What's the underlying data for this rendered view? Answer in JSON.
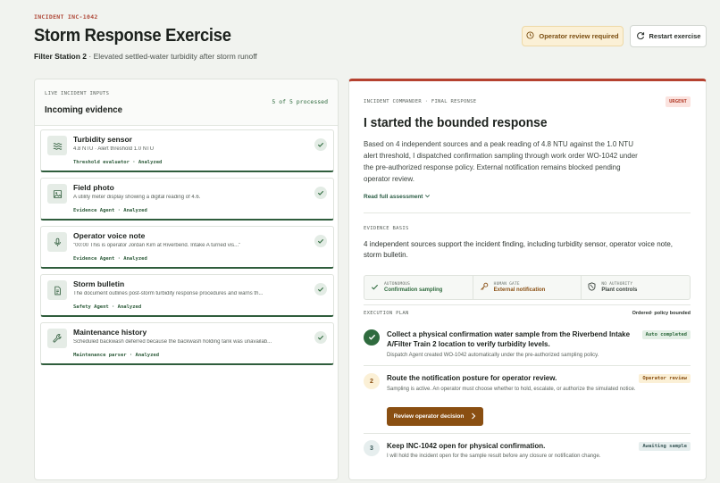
{
  "header": {
    "incident_code": "INCIDENT INC-1042",
    "title": "Storm Response Exercise",
    "station": "Filter Station 2",
    "subtitle": "· Elevated settled-water turbidity after storm runoff",
    "review_button": "Operator review required",
    "restart_button": "Restart exercise"
  },
  "evidence_panel": {
    "label": "LIVE INCIDENT INPUTS",
    "title": "Incoming evidence",
    "count": "5 of 5 processed",
    "items": [
      {
        "title": "Turbidity sensor",
        "desc": "4.8 NTU · Alert threshold 1.0 NTU",
        "agent": "Threshold evaluator · Analyzed",
        "icon": "waves-icon"
      },
      {
        "title": "Field photo",
        "desc": "A utility meter display showing a digital reading of 4.6.",
        "agent": "Evidence Agent · Analyzed",
        "icon": "image-icon"
      },
      {
        "title": "Operator voice note",
        "desc": "\"00:00 This is operator Jordan Kim at Riverbend. Intake A turned vis...\"",
        "agent": "Evidence Agent · Analyzed",
        "icon": "microphone-icon"
      },
      {
        "title": "Storm bulletin",
        "desc": "The document outlines post-storm turbidity response procedures and warns th...",
        "agent": "Safety Agent · Analyzed",
        "icon": "document-icon"
      },
      {
        "title": "Maintenance history",
        "desc": "Scheduled backwash deferred because the backwash holding tank was unavailab...",
        "agent": "Maintenance parser · Analyzed",
        "icon": "wrench-icon"
      }
    ]
  },
  "response": {
    "label": "INCIDENT COMMANDER · FINAL RESPONSE",
    "urgency": "URGENT",
    "title": "I started the bounded response",
    "body": "Based on 4 independent sources and a peak reading of 4.8 NTU against the 1.0 NTU alert threshold, I dispatched confirmation sampling through work order WO-1042 under the pre-authorized response policy. External notification remains blocked pending operator review.",
    "read_more": "Read full assessment",
    "basis_label": "EVIDENCE BASIS",
    "basis_text": "4 independent sources support the incident finding, including turbidity sensor, operator voice note, storm bulletin.",
    "modes": [
      {
        "small": "AUTONOMOUS",
        "label": "Confirmation sampling",
        "color": "#2f6b3e"
      },
      {
        "small": "HUMAN GATE",
        "label": "External notification",
        "color": "#8a4f12"
      },
      {
        "small": "NO AUTHORITY",
        "label": "Plant controls",
        "color": "#3e4640"
      }
    ],
    "exec_label": "EXECUTION PLAN",
    "exec_order": "Ordered· policy bounded",
    "steps": [
      {
        "num": "✓",
        "title": "Collect a physical confirmation water sample from the Riverbend Intake A/Filter Train 2 location to verify turbidity levels.",
        "desc": "Dispatch Agent created WO-1042 automatically under the pre-authorized sampling policy.",
        "badge": "Auto completed"
      },
      {
        "num": "2",
        "title": "Route the notification posture for operator review.",
        "desc": "Sampling is active. An operator must choose whether to hold, escalate, or authorize the simulated notice.",
        "badge": "Operator review"
      },
      {
        "num": "3",
        "title": "Keep INC-1042 open for physical confirmation.",
        "desc": "I will hold the incident open for the sample result before any closure or notification change.",
        "badge": "Awaiting sample"
      }
    ],
    "decision_button": "Review operator decision"
  }
}
